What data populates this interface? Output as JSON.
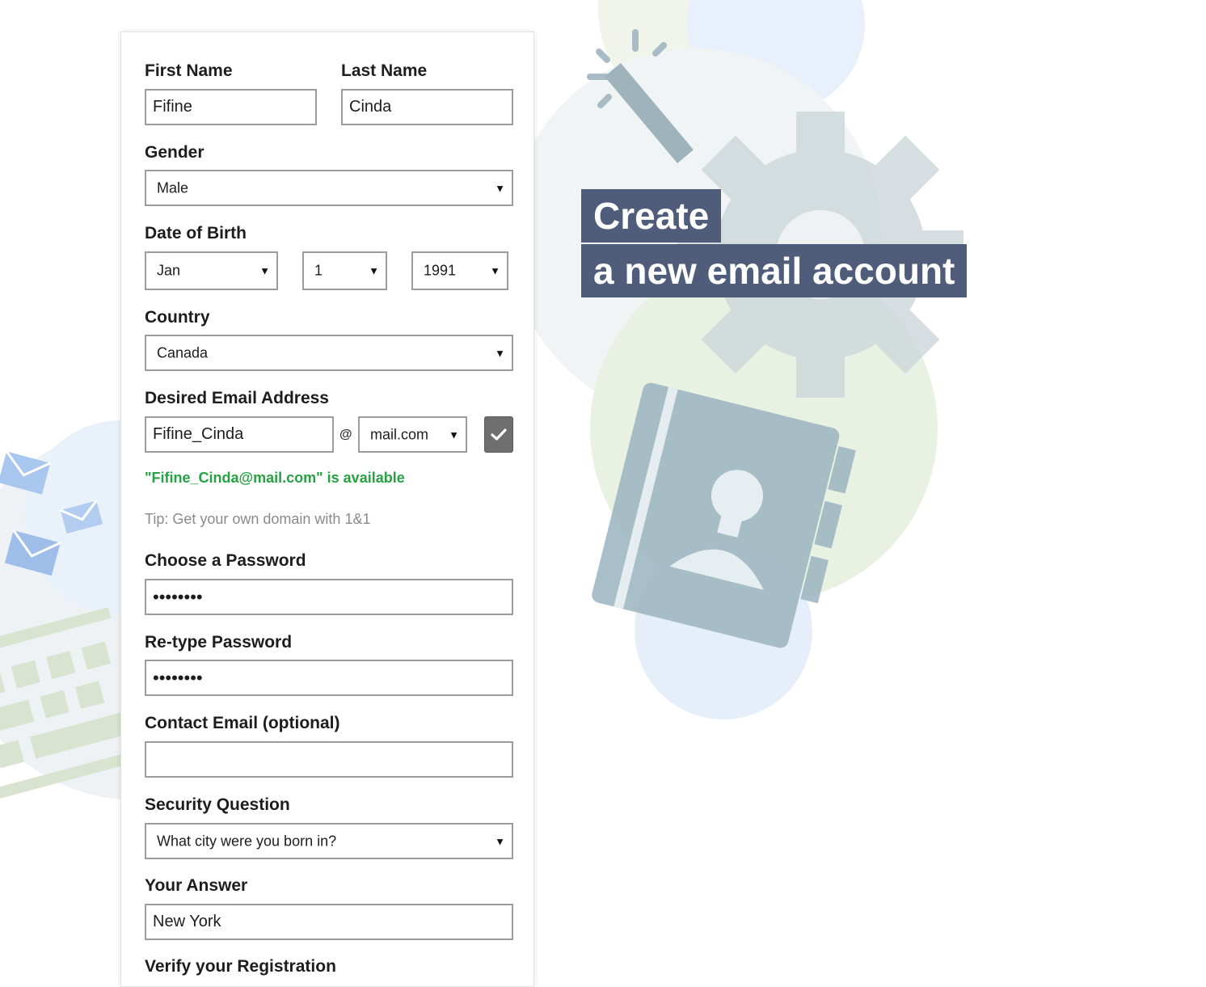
{
  "headline": {
    "line1": "Create",
    "line2": "a new email account"
  },
  "form": {
    "first_name": {
      "label": "First Name",
      "value": "Fifine"
    },
    "last_name": {
      "label": "Last Name",
      "value": "Cinda"
    },
    "gender": {
      "label": "Gender",
      "value": "Male"
    },
    "dob": {
      "label": "Date of Birth",
      "month": "Jan",
      "day": "1",
      "year": "1991"
    },
    "country": {
      "label": "Country",
      "value": "Canada"
    },
    "email": {
      "label": "Desired Email Address",
      "username": "Fifine_Cinda",
      "at": "@",
      "domain": "mail.com",
      "available_msg": "\"Fifine_Cinda@mail.com\" is available",
      "tip": "Tip: Get your own domain with 1&1"
    },
    "password": {
      "label": "Choose a Password",
      "value": "••••••••"
    },
    "retype_password": {
      "label": "Re-type Password",
      "value": "••••••••"
    },
    "contact_email": {
      "label": "Contact Email (optional)",
      "value": ""
    },
    "security_question": {
      "label": "Security Question",
      "value": "What city were you born in?"
    },
    "answer": {
      "label": "Your Answer",
      "value": "New York"
    },
    "verify": {
      "label": "Verify your Registration"
    }
  },
  "icons": {
    "dropdown": "chevron-down-icon",
    "check": "checkmark-icon",
    "illustrations": [
      "magic-wand-icon",
      "gear-icon",
      "address-book-icon",
      "envelope-icon",
      "keyboard-icon"
    ]
  },
  "colors": {
    "headline_bg": "#4f5d7a",
    "available_text": "#27a243",
    "check_button": "#6e6e6e",
    "field_border": "#9c9c9c"
  }
}
